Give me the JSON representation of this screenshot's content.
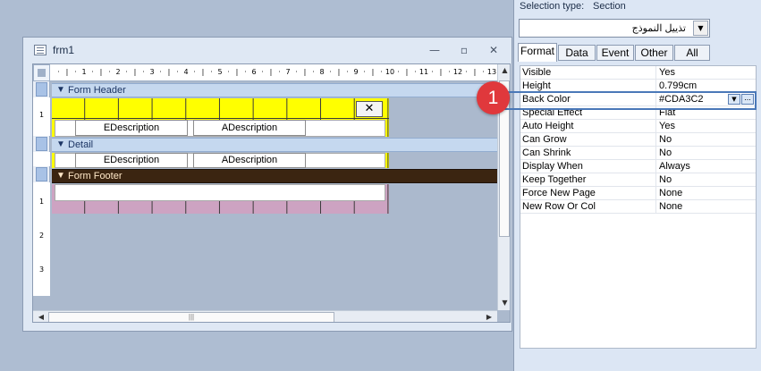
{
  "window": {
    "title": "frm1",
    "minimize_glyph": "—",
    "restore_glyph": "▫",
    "close_glyph": "✕"
  },
  "ruler": {
    "horizontal_numbers": [
      "1",
      "2",
      "3",
      "4",
      "5",
      "6",
      "7",
      "8",
      "9",
      "10",
      "11",
      "12",
      "13"
    ],
    "vertical_numbers": [
      "1",
      "1",
      "2",
      "3"
    ]
  },
  "sections": {
    "header": {
      "label": "Form Header",
      "icon": "chevron-down-icon"
    },
    "detail": {
      "label": "Detail",
      "icon": "chevron-down-icon"
    },
    "footer": {
      "label": "Form Footer",
      "icon": "chevron-down-icon"
    }
  },
  "controls": {
    "header_field_1": "EDescription",
    "header_field_2": "ADescription",
    "detail_field_1": "EDescription",
    "detail_field_2": "ADescription",
    "close_button_glyph": "✕"
  },
  "property_sheet": {
    "selection_label": "Selection type:",
    "selection_type": "Section",
    "dropdown_value": "تذييل النموذج",
    "tabs": [
      "Format",
      "Data",
      "Event",
      "Other",
      "All"
    ],
    "active_tab": "Format",
    "properties": [
      {
        "name": "Visible",
        "value": "Yes"
      },
      {
        "name": "Height",
        "value": "0.799cm"
      },
      {
        "name": "Back Color",
        "value": "#CDA3C2"
      },
      {
        "name": "Special Effect",
        "value": "Flat"
      },
      {
        "name": "Auto Height",
        "value": "Yes"
      },
      {
        "name": "Can Grow",
        "value": "No"
      },
      {
        "name": "Can Shrink",
        "value": "No"
      },
      {
        "name": "Display When",
        "value": "Always"
      },
      {
        "name": "Keep Together",
        "value": "No"
      },
      {
        "name": "Force New Page",
        "value": "None"
      },
      {
        "name": "New Row Or Col",
        "value": "None"
      }
    ],
    "ellipsis_glyph": "..."
  },
  "callout": {
    "number": "1"
  },
  "colors": {
    "header_back": "#ffff00",
    "footer_back": "#CDA3C2",
    "footer_bar": "#3b2511",
    "callout": "#e0383c"
  }
}
